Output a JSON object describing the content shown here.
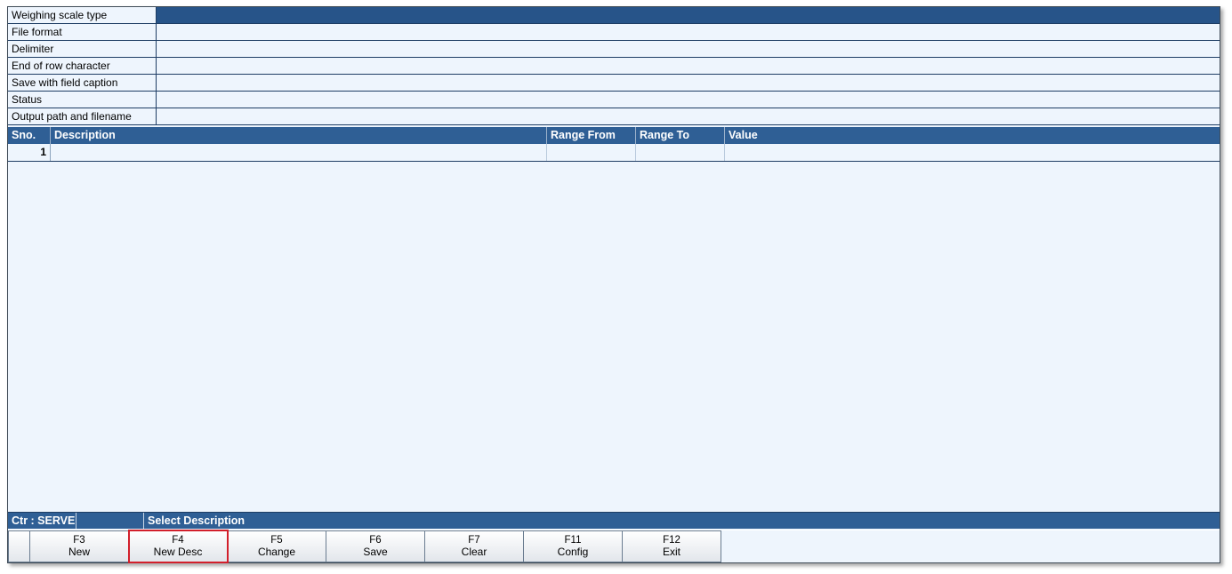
{
  "form": {
    "fields": [
      {
        "label": "Weighing scale type",
        "value": ""
      },
      {
        "label": "File format",
        "value": ""
      },
      {
        "label": "Delimiter",
        "value": ""
      },
      {
        "label": "End of row character",
        "value": ""
      },
      {
        "label": "Save with field caption",
        "value": ""
      },
      {
        "label": "Status",
        "value": ""
      },
      {
        "label": "Output path and filename",
        "value": ""
      }
    ]
  },
  "grid": {
    "columns": [
      "Sno.",
      "Description",
      "Range From",
      "Range To",
      "Value"
    ],
    "rows": [
      {
        "sno": "1",
        "description": "",
        "range_from": "",
        "range_to": "",
        "value": ""
      }
    ]
  },
  "status_bar": {
    "counter": "Ctr : SERVER",
    "message": "Select Description"
  },
  "function_keys": [
    {
      "key": "F3",
      "label": "New"
    },
    {
      "key": "F4",
      "label": "New Desc",
      "highlighted": true
    },
    {
      "key": "F5",
      "label": "Change"
    },
    {
      "key": "F6",
      "label": "Save"
    },
    {
      "key": "F7",
      "label": "Clear"
    },
    {
      "key": "F11",
      "label": "Config"
    },
    {
      "key": "F12",
      "label": "Exit"
    }
  ],
  "colors": {
    "header_blue": "#2f5f95",
    "selected_field": "#275489",
    "background": "#eef5fd",
    "highlight_outline": "#d21f2b"
  }
}
